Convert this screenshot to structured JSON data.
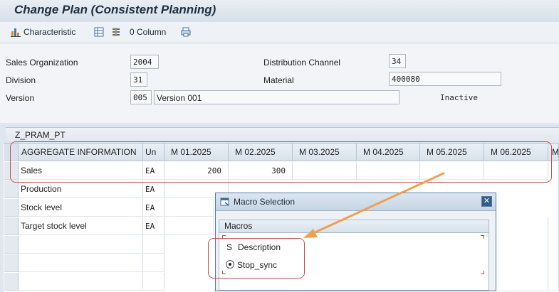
{
  "window": {
    "title": "Change Plan (Consistent Planning)"
  },
  "toolbar": {
    "characteristic_label": "Characteristic",
    "column_label": "0 Column"
  },
  "form": {
    "sales_org_label": "Sales Organization",
    "sales_org_value": "2004",
    "dist_channel_label": "Distribution Channel",
    "dist_channel_value": "34",
    "division_label": "Division",
    "division_value": "31",
    "material_label": "Material",
    "material_value": "400080",
    "version_label": "Version",
    "version_code": "005",
    "version_desc": "Version 001",
    "status": "Inactive"
  },
  "planning_table": {
    "tab_label": "Z_PRAM_PT",
    "headers": [
      "AGGREGATE INFORMATION",
      "Un",
      "M 01.2025",
      "M 02.2025",
      "M 03.2025",
      "M 04.2025",
      "M 05.2025",
      "M 06.2025",
      "M"
    ],
    "rows": [
      {
        "name": "Sales",
        "unit": "EA",
        "m01": "200",
        "m02": "300"
      },
      {
        "name": "Production",
        "unit": "EA",
        "m01": "",
        "m02": ""
      },
      {
        "name": "Stock level",
        "unit": "EA",
        "m01": "",
        "m02": ""
      },
      {
        "name": "Target stock level",
        "unit": "EA",
        "m01": "",
        "m02": ""
      }
    ]
  },
  "dialog": {
    "title": "Macro Selection",
    "close_label": "✕",
    "group_title": "Macros",
    "col_s": "S",
    "col_description": "Description",
    "option_label": "Stop_sync"
  },
  "colors": {
    "annotation": "#c0504d",
    "arrow": "#f0a050",
    "accent": "#2f5e8e"
  }
}
